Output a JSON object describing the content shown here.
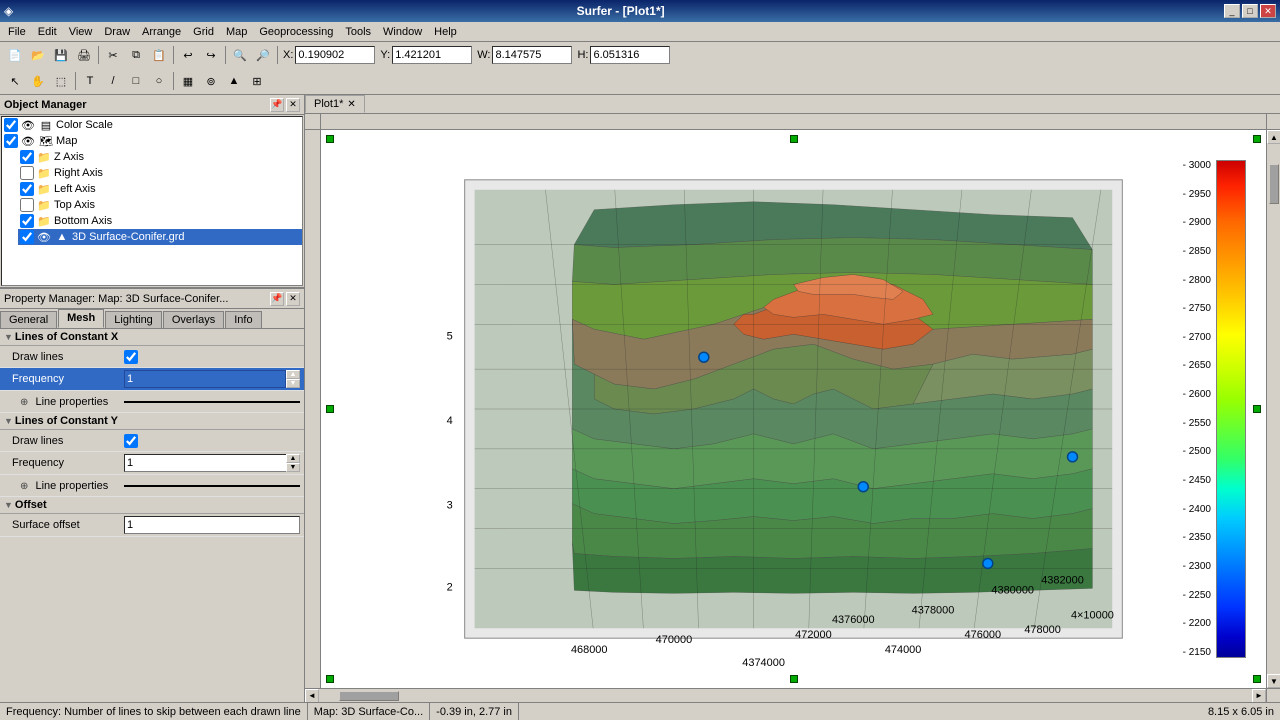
{
  "window": {
    "title": "Surfer - [Plot1*]",
    "app_icon": "◈"
  },
  "title_bar": {
    "controls": [
      "_",
      "□",
      "✕"
    ]
  },
  "menu": {
    "items": [
      "File",
      "Edit",
      "View",
      "Draw",
      "Arrange",
      "Grid",
      "Map",
      "Geoprocessing",
      "Tools",
      "Window",
      "Help"
    ]
  },
  "coord_bar": {
    "x_label": "X:",
    "x_value": "0.190902",
    "y_label": "Y:",
    "y_value": "1.421201",
    "w_label": "W:",
    "w_value": "8.147575",
    "h_label": "H:",
    "h_value": "6.051316"
  },
  "object_manager": {
    "title": "Object Manager",
    "items": [
      {
        "id": "color-scale",
        "label": "Color Scale",
        "level": 0,
        "checked": true,
        "eye": true
      },
      {
        "id": "map",
        "label": "Map",
        "level": 0,
        "checked": true,
        "eye": true
      },
      {
        "id": "z-axis",
        "label": "Z Axis",
        "level": 1,
        "checked": true,
        "eye": false
      },
      {
        "id": "right-axis",
        "label": "Right Axis",
        "level": 1,
        "checked": false,
        "eye": false
      },
      {
        "id": "left-axis",
        "label": "Left Axis",
        "level": 1,
        "checked": true,
        "eye": false
      },
      {
        "id": "top-axis",
        "label": "Top Axis",
        "level": 1,
        "checked": false,
        "eye": false
      },
      {
        "id": "bottom-axis",
        "label": "Bottom Axis",
        "level": 1,
        "checked": true,
        "eye": false
      },
      {
        "id": "3d-surface",
        "label": "3D Surface-Conifer.grd",
        "level": 1,
        "checked": true,
        "eye": true,
        "selected": true
      }
    ]
  },
  "property_manager": {
    "title": "Property Manager: Map: 3D Surface-Conifer...",
    "tabs": [
      "General",
      "Mesh",
      "Lighting",
      "Overlays",
      "Info"
    ],
    "active_tab": "Mesh",
    "sections": {
      "constant_x": {
        "label": "Lines of Constant X",
        "draw_lines_label": "Draw lines",
        "draw_lines_checked": true,
        "frequency_label": "Frequency",
        "frequency_value": "1",
        "line_props_label": "Line properties"
      },
      "constant_y": {
        "label": "Lines of Constant Y",
        "draw_lines_label": "Draw lines",
        "draw_lines_checked": true,
        "frequency_label": "Frequency",
        "frequency_value": "1",
        "line_props_label": "Line properties"
      },
      "offset": {
        "label": "Offset",
        "surface_offset_label": "Surface offset",
        "surface_offset_value": "1"
      }
    }
  },
  "doc_tabs": [
    {
      "label": "Plot1*",
      "active": true,
      "closable": true
    }
  ],
  "color_scale": {
    "labels": [
      "3000",
      "2950",
      "2900",
      "2850",
      "2800",
      "2750",
      "2700",
      "2650",
      "2600",
      "2550",
      "2500",
      "2450",
      "2400",
      "2350",
      "2300",
      "2250",
      "2200",
      "2150"
    ]
  },
  "status_bar": {
    "message": "Frequency: Number of lines to skip between each drawn line",
    "map_info": "Map: 3D Surface-Co...",
    "coords": "-0.39 in, 2.77 in",
    "dimensions": "8.15 x 6.05 in"
  }
}
